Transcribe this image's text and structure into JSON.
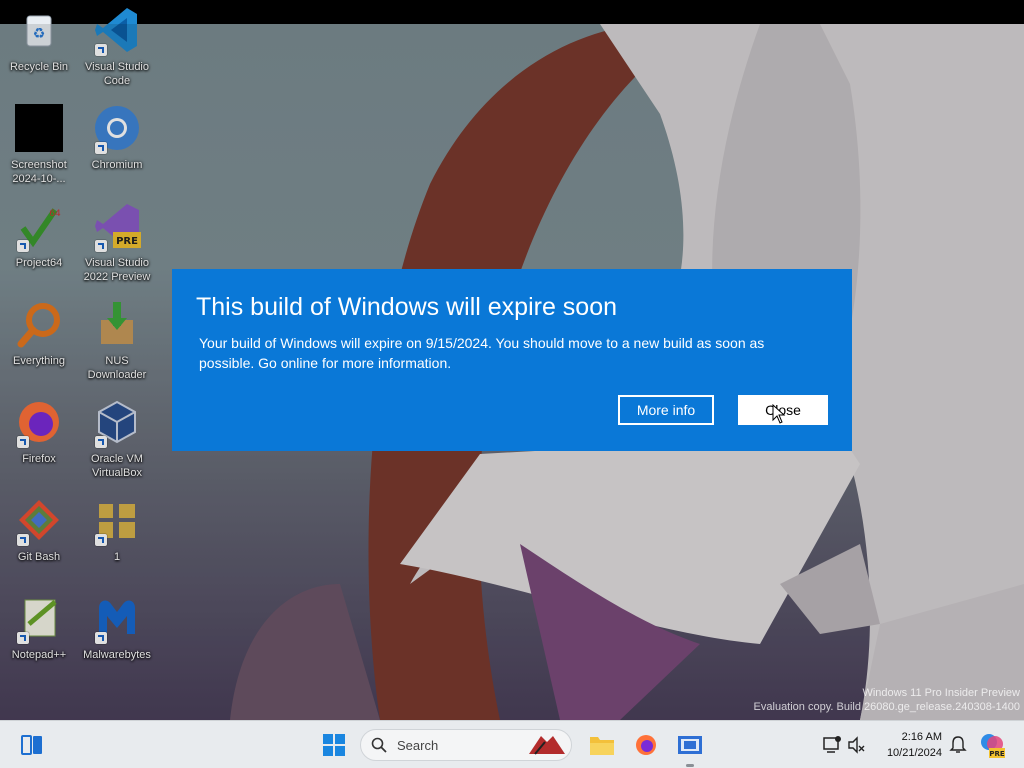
{
  "desktop": {
    "icons": [
      {
        "label": "Recycle Bin",
        "icon": "recycle-bin-icon"
      },
      {
        "label": "Visual Studio Code",
        "icon": "vscode-icon"
      },
      {
        "label": "Screenshot 2024-10-...",
        "icon": "screenshot-file-icon"
      },
      {
        "label": "Chromium",
        "icon": "chromium-icon"
      },
      {
        "label": "Project64",
        "icon": "project64-icon"
      },
      {
        "label": "Visual Studio 2022 Preview",
        "icon": "visual-studio-preview-icon"
      },
      {
        "label": "Everything",
        "icon": "everything-search-icon"
      },
      {
        "label": "NUS Downloader",
        "icon": "nus-downloader-icon"
      },
      {
        "label": "Firefox",
        "icon": "firefox-icon"
      },
      {
        "label": "Oracle VM VirtualBox",
        "icon": "virtualbox-icon"
      },
      {
        "label": "Git Bash",
        "icon": "git-bash-icon"
      },
      {
        "label": "1",
        "icon": "folder-shortcut-icon"
      },
      {
        "label": "Notepad++",
        "icon": "notepadpp-icon"
      },
      {
        "label": "Malwarebytes",
        "icon": "malwarebytes-icon"
      }
    ],
    "pre_badge": "PRE",
    "project64_badge": "64"
  },
  "dialog": {
    "title": "This build of Windows will expire soon",
    "message": "Your build of Windows will expire on 9/15/2024. You should move to a new build as soon as possible. Go online for more information.",
    "more_info_label": "More info",
    "close_label": "Close",
    "background": "#0a78d7"
  },
  "watermark": {
    "line1": "Windows 11 Pro Insider Preview",
    "line2": "Evaluation copy. Build 26080.ge_release.240308-1400"
  },
  "taskbar": {
    "search_placeholder": "Search",
    "time": "2:16 AM",
    "date": "10/21/2024",
    "tray_badge": "PRE"
  }
}
